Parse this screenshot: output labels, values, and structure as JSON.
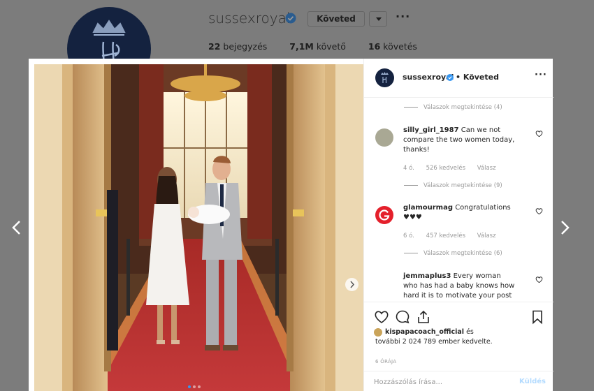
{
  "profile": {
    "username": "sussexroyal",
    "follow_button": "Követed",
    "posts_count": "22",
    "posts_label": "bejegyzés",
    "followers_count": "7,1M",
    "followers_label": "követő",
    "following_count": "16",
    "following_label": "követés"
  },
  "post": {
    "username": "sussexroyal",
    "following_label": "• Követed",
    "likes_user": "kispapacoach_official",
    "likes_connector": "és",
    "likes_rest": "további 2 024 789 ember kedvelte.",
    "time_ago": "6 ÓRÁJA",
    "comment_placeholder": "Hozzászólás írása...",
    "post_button": "Küldés"
  },
  "comments": [
    {
      "type": "replies",
      "label": "Válaszok megtekintése (4)"
    },
    {
      "type": "comment",
      "user": "silly_girl_1987",
      "text": "Can we not compare the two women today, thanks!",
      "time": "4 ó.",
      "likes": "526 kedvelés",
      "reply": "Válasz"
    },
    {
      "type": "replies",
      "label": "Válaszok megtekintése (9)"
    },
    {
      "type": "comment",
      "user": "glamourmag",
      "text": "Congratulations ♥♥♥",
      "time": "6 ó.",
      "likes": "457 kedvelés",
      "reply": "Válasz"
    },
    {
      "type": "replies",
      "label": "Válaszok megtekintése (6)"
    },
    {
      "type": "comment",
      "user": "jemmaplus3",
      "text": "Every woman who has had a baby knows how hard it is to motivate your post baby"
    }
  ],
  "icons": {
    "verified": "verified-badge-icon",
    "like": "heart-icon",
    "comment": "comment-icon",
    "share": "share-icon",
    "save": "bookmark-icon",
    "prev": "chevron-left-icon",
    "next": "chevron-right-icon"
  },
  "colors": {
    "accent": "#3897f0",
    "brand_navy": "#14223f",
    "glamour_red": "#e4202b",
    "carpet_red": "#b8302c"
  }
}
